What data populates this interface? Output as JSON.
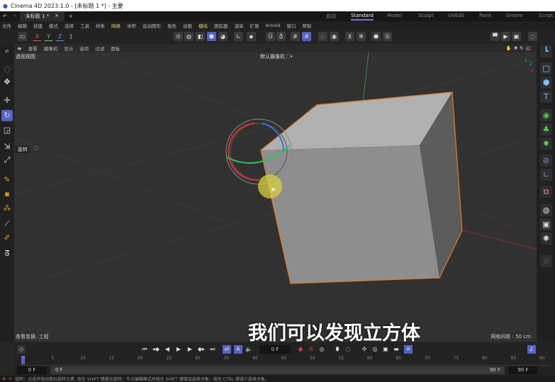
{
  "title": "Cinema 4D 2023.1.0 - [未标题 1 *] - 主要",
  "doc_tab": "未标题 1 *",
  "tab_close": "×",
  "tab_add": "+",
  "layouts": [
    "启动",
    "Standard",
    "Model",
    "Sculpt",
    "UVEdit",
    "Paint",
    "Groom",
    "Script"
  ],
  "menu": [
    "文件",
    "编辑",
    "创建",
    "模式",
    "选择",
    "工具",
    "样条",
    "网格",
    "体积",
    "运动图形",
    "角色",
    "动画",
    "模拟",
    "跟踪器",
    "渲染",
    "扩展",
    "Arnold",
    "窗口",
    "帮助"
  ],
  "axes": [
    "X",
    "Y",
    "Z"
  ],
  "viewport_menu": [
    "查看",
    "摄像机",
    "显示",
    "选项",
    "过滤",
    "面板"
  ],
  "viewport_name": "透视视图",
  "camera": "默认摄像机 ⛶•",
  "tool_label": "旋转",
  "view_transform": "查看变换: 工程",
  "grid_spacing": "网格间距 : 50 cm",
  "subtitle": "我们可以发现立方体",
  "timeline": {
    "current_frame": "0 F",
    "ticks": [
      "0",
      "5",
      "10",
      "15",
      "20",
      "25",
      "30",
      "35",
      "40",
      "45",
      "50",
      "55",
      "60",
      "65",
      "70",
      "75",
      "80",
      "85",
      "90"
    ],
    "start": "0 F",
    "range_start": "0 F",
    "range_end": "90 F",
    "end": "90 F"
  },
  "status": "旋转：点击并拖动鼠标旋转元素. 按住 SHIFT 键量化旋转；节点编辑模式时按住 SHIFT 键增加选择对象；按住 CTRL 键减少选择对象。",
  "colors": {
    "accent": "#5563c4",
    "cube_edge": "#e07a2a"
  }
}
